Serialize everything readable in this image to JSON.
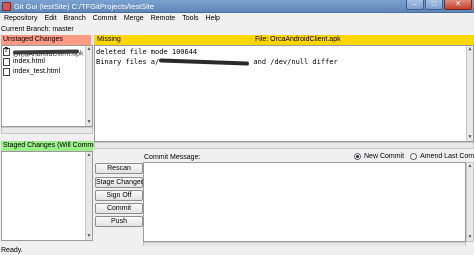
{
  "window": {
    "title": "Git Gui (testSite) C:/TFGitProjects/testSite",
    "controls": [
      "–",
      "□",
      "✕"
    ]
  },
  "menu": [
    "Repository",
    "Edit",
    "Branch",
    "Commit",
    "Merge",
    "Remote",
    "Tools",
    "Help"
  ],
  "branch": "Current Branch: master",
  "unstaged": {
    "header": "Unstaged Changes",
    "files": [
      {
        "name": "OrcaAndroidClient.apk",
        "icon": "unknown-file-icon",
        "selected": true
      },
      {
        "name": "index.html",
        "icon": "file-icon",
        "selected": false
      },
      {
        "name": "index_test.html",
        "icon": "file-icon",
        "selected": false
      }
    ]
  },
  "staged": {
    "header": "Staged Changes (Will Commit)"
  },
  "diff": {
    "status": "Missing",
    "file_label": "File:  OrcaAndroidClient.apk",
    "lines": {
      "line1": "deleted file mode 100644",
      "line2_prefix": "Binary files a/",
      "line2_suffix": " and /dev/null differ"
    }
  },
  "commit": {
    "buttons": [
      "Rescan",
      "Stage Changed",
      "Sign Off",
      "Commit",
      "Push"
    ],
    "message_label": "Commit Message:",
    "message_value": "",
    "new_commit": "New Commit",
    "amend": "Amend Last Commit",
    "selected_mode": "New Commit"
  },
  "status": "Ready.",
  "colors": {
    "unstaged_header": "#ff9a85",
    "staged_header": "#9bf08a",
    "diff_header": "#ffd700"
  }
}
